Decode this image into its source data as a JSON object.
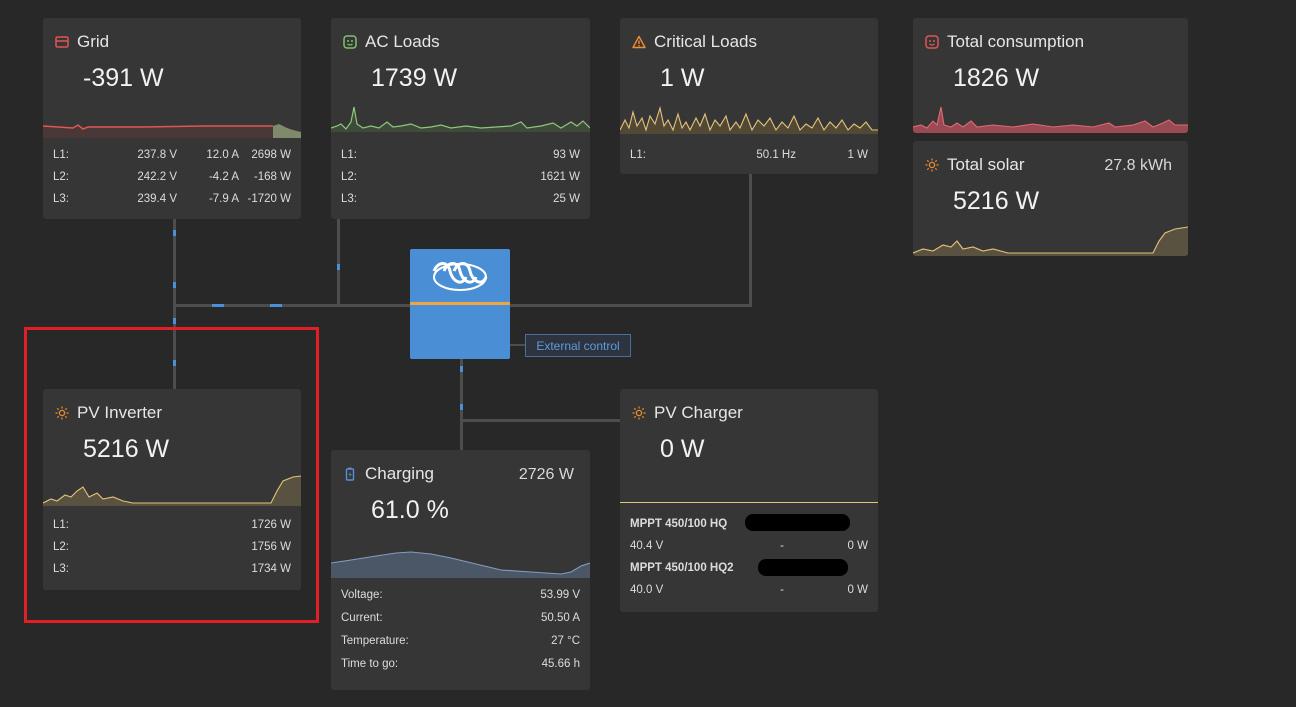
{
  "grid": {
    "title": "Grid",
    "value": "-391 W",
    "icon": "grid-icon",
    "phases": [
      {
        "label": "L1:",
        "voltage": "237.8 V",
        "current": "12.0 A",
        "power": "2698 W"
      },
      {
        "label": "L2:",
        "voltage": "242.2 V",
        "current": "-4.2 A",
        "power": "-168 W"
      },
      {
        "label": "L3:",
        "voltage": "239.4 V",
        "current": "-7.9 A",
        "power": "-1720 W"
      }
    ]
  },
  "ac_loads": {
    "title": "AC Loads",
    "value": "1739 W",
    "icon": "ac-loads-icon",
    "phases": [
      {
        "label": "L1:",
        "power": "93 W"
      },
      {
        "label": "L2:",
        "power": "1621 W"
      },
      {
        "label": "L3:",
        "power": "25 W"
      }
    ]
  },
  "critical_loads": {
    "title": "Critical Loads",
    "value": "1 W",
    "icon": "warning-icon",
    "phases": [
      {
        "label": "L1:",
        "frequency": "50.1 Hz",
        "power": "1 W"
      }
    ]
  },
  "total_consumption": {
    "title": "Total consumption",
    "value": "1826 W",
    "icon": "consumption-icon"
  },
  "total_solar": {
    "title": "Total solar",
    "value": "5216 W",
    "energy": "27.8 kWh",
    "icon": "sun-icon"
  },
  "pv_inverter": {
    "title": "PV Inverter",
    "value": "5216 W",
    "icon": "sun-icon",
    "phases": [
      {
        "label": "L1:",
        "power": "1726 W"
      },
      {
        "label": "L2:",
        "power": "1756 W"
      },
      {
        "label": "L3:",
        "power": "1734 W"
      }
    ]
  },
  "battery": {
    "title": "Charging",
    "value": "61.0 %",
    "power": "2726 W",
    "icon": "battery-icon",
    "details": [
      {
        "label": "Voltage:",
        "value": "53.99 V"
      },
      {
        "label": "Current:",
        "value": "50.50 A"
      },
      {
        "label": "Temperature:",
        "value": "27 °C"
      },
      {
        "label": "Time to go:",
        "value": "45.66 h"
      }
    ]
  },
  "pv_charger": {
    "title": "PV Charger",
    "value": "0 W",
    "icon": "sun-icon",
    "chargers": [
      {
        "name": "MPPT 450/100 HQ",
        "voltage": "40.4 V",
        "current": "-",
        "power": "0 W"
      },
      {
        "name": "MPPT 450/100 HQ2",
        "voltage": "40.0 V",
        "current": "-",
        "power": "0 W"
      }
    ]
  },
  "external_control": "External control",
  "colors": {
    "background": "#282828",
    "card": "#363636",
    "grid_accent": "#e05555",
    "ac_accent": "#7fc26a",
    "warning_accent": "#f08c30",
    "solar_accent": "#e6c37a",
    "battery_accent": "#5a8fd8",
    "device_blue": "#4a8fd6",
    "device_stripe": "#f0a640",
    "highlight": "#e01f26"
  }
}
